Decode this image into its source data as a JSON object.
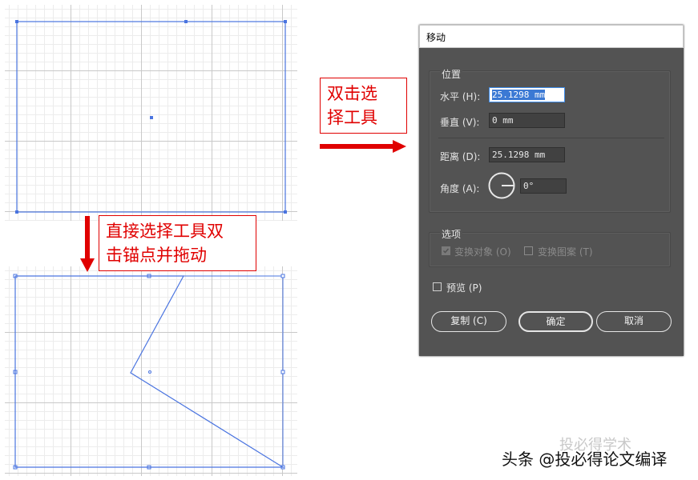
{
  "annotations": {
    "callout_top": "双击选\n择工具",
    "callout_middle": "直接选择工具双\n击锚点并拖动"
  },
  "colors": {
    "accent_red": "#e00000",
    "path_blue": "#4a74e0",
    "dialog_bg": "#535353"
  },
  "dialog": {
    "title": "移动",
    "position_group": {
      "label": "位置",
      "horizontal": {
        "label": "水平 (H):",
        "value": "25.1298 mm"
      },
      "vertical": {
        "label": "垂直 (V):",
        "value": "0 mm"
      },
      "distance": {
        "label": "距离 (D):",
        "value": "25.1298 mm"
      },
      "angle": {
        "label": "角度 (A):",
        "value": "0°"
      }
    },
    "options_group": {
      "label": "选项",
      "transform_objects": {
        "label": "变换对象 (O)",
        "checked": true
      },
      "transform_patterns": {
        "label": "变换图案 (T)",
        "checked": false
      }
    },
    "preview": {
      "label": "预览 (P)",
      "checked": false
    },
    "buttons": {
      "copy": "复制 (C)",
      "ok": "确定",
      "cancel": "取消"
    }
  },
  "watermark": {
    "text": "头条 @投必得论文编译",
    "ghost": "投必得学术"
  }
}
